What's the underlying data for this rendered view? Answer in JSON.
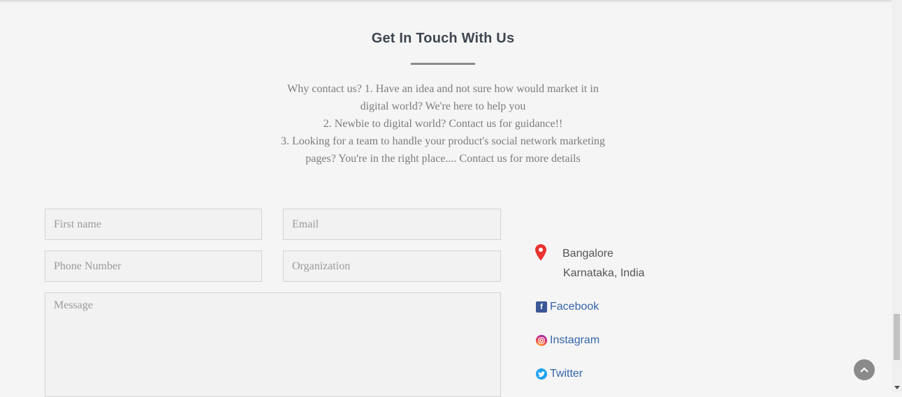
{
  "section": {
    "title": "Get In Touch With Us",
    "intro_lines": [
      "Why contact us? 1. Have an idea and not sure how would market it in",
      "digital world? We're here to help you",
      "2. Newbie to digital world? Contact us for guidance!!",
      "3. Looking for a team to handle your product's social network marketing",
      "pages? You're in the right place.... Contact us for more details"
    ]
  },
  "form": {
    "first_name": {
      "placeholder": "First name",
      "value": ""
    },
    "email": {
      "placeholder": "Email",
      "value": ""
    },
    "phone": {
      "placeholder": "Phone Number",
      "value": ""
    },
    "organization": {
      "placeholder": "Organization",
      "value": ""
    },
    "message": {
      "placeholder": "Message",
      "value": ""
    }
  },
  "contact": {
    "city": "Bangalore",
    "region": "Karnataka, India",
    "location_icon": "map-pin-icon",
    "links": [
      {
        "label": "Facebook",
        "icon": "facebook-icon"
      },
      {
        "label": "Instagram",
        "icon": "instagram-icon"
      },
      {
        "label": "Twitter",
        "icon": "twitter-icon"
      }
    ]
  },
  "colors": {
    "background": "#f5f5f5",
    "title": "#3f4650",
    "link": "#3566a8",
    "pin": "#e8322e"
  }
}
